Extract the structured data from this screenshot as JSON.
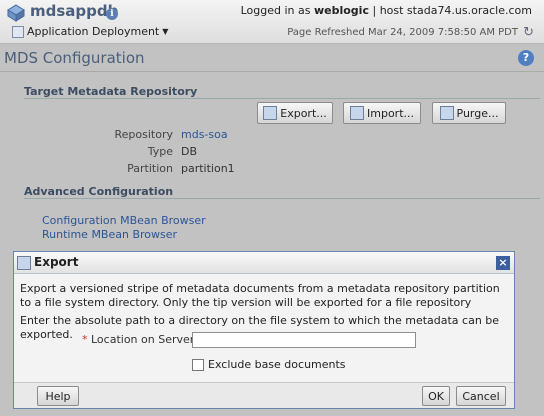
{
  "header": {
    "app_title": "mdsappdb",
    "app_menu_label": "Application Deployment",
    "logged_in_prefix": "Logged in as",
    "username": "weblogic",
    "host_text": "host stada74.us.oracle.com",
    "refresh_text": "Page Refreshed Mar 24, 2009 7:58:50 AM PDT"
  },
  "page": {
    "title": "MDS Configuration",
    "target_section": "Target Metadata Repository",
    "buttons": {
      "export": "Export...",
      "import": "Import...",
      "purge": "Purge..."
    },
    "fields": {
      "repository_label": "Repository",
      "repository_value": "mds-soa",
      "type_label": "Type",
      "type_value": "DB",
      "partition_label": "Partition",
      "partition_value": "partition1"
    },
    "advanced_section": "Advanced Configuration",
    "links": {
      "config_mbean": "Configuration MBean Browser",
      "runtime_mbean": "Runtime MBean Browser"
    }
  },
  "dialog": {
    "title": "Export",
    "description": "Export a versioned stripe of metadata documents from a metadata repository partition to a file system directory. Only the tip version will be exported for a file repository",
    "instruction": "Enter the absolute path to a directory on the file system to which the metadata can be exported.",
    "required_marker": "*",
    "location_label": "Location on Server",
    "location_value": "",
    "exclude_label": "Exclude base documents",
    "help_button": "Help",
    "ok_button": "OK",
    "cancel_button": "Cancel"
  }
}
